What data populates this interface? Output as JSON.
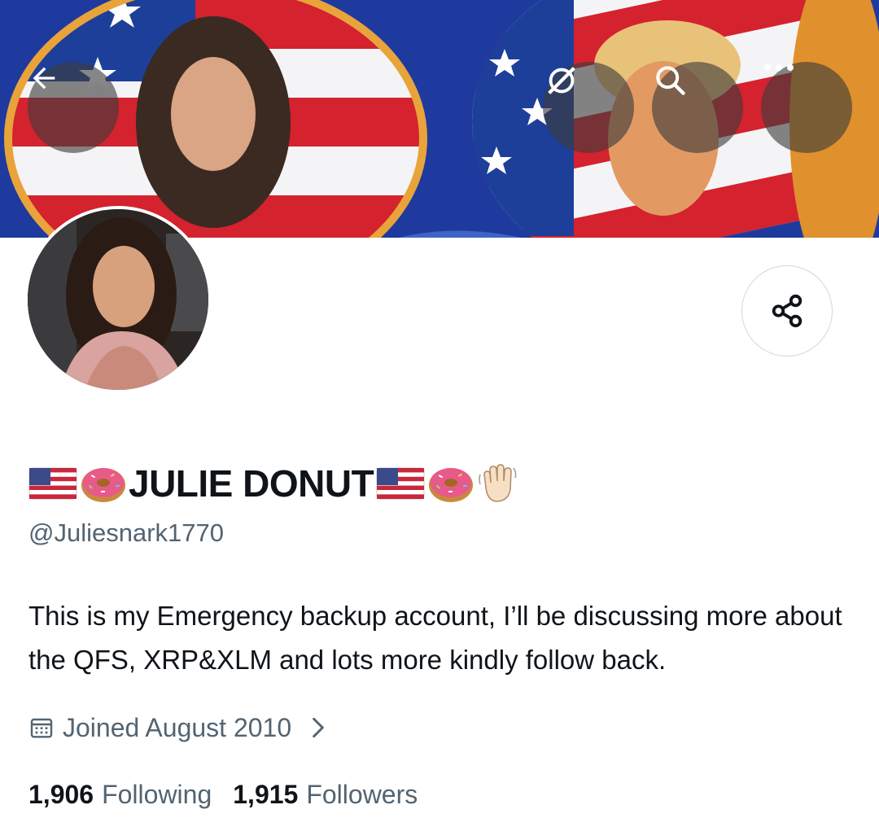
{
  "profile": {
    "display_name": "JULIE DONUT",
    "name_emojis_before": [
      "us-flag-emoji",
      "donut-emoji"
    ],
    "name_emojis_after": [
      "us-flag-emoji",
      "donut-emoji",
      "waving-hand-emoji"
    ],
    "handle": "@Juliesnark1770",
    "bio": "This is my Emergency backup account, I’ll be discussing more about the QFS, XRP&XLM and lots more kindly follow back.",
    "joined": "Joined August 2010",
    "following_count": "1,906",
    "following_label": "Following",
    "followers_count": "1,915",
    "followers_label": "Followers"
  },
  "toolbar": {
    "back_icon": "arrow-left-icon",
    "grok_icon": "grok-icon",
    "search_icon": "search-icon",
    "more_icon": "more-horizontal-icon",
    "share_icon": "share-icon"
  },
  "colors": {
    "text_primary": "#0f1419",
    "text_secondary": "#536471",
    "border": "#cfd9de",
    "banner_blue": "#1f3a9e"
  }
}
